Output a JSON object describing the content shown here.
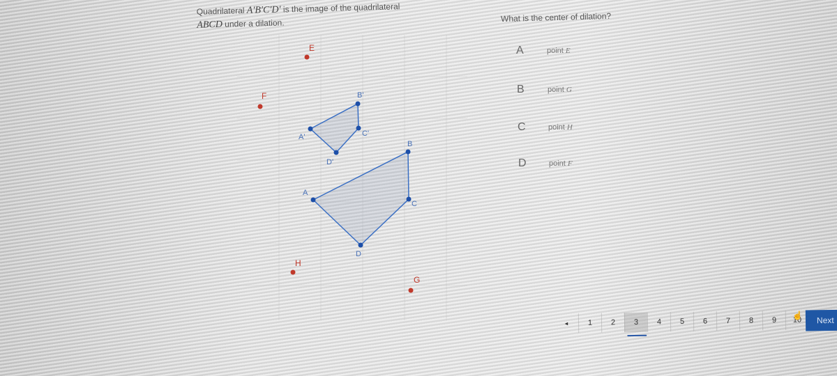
{
  "prompt": {
    "prefix": "Quadrilateral",
    "image_name": "A′B′C′D′",
    "middle": "is the image of the quadrilateral",
    "original_name": "ABCD",
    "suffix": "under a dilation."
  },
  "graph": {
    "points": {
      "E": {
        "label": "E",
        "color": "#c0392b"
      },
      "F": {
        "label": "F",
        "color": "#c0392b"
      },
      "G": {
        "label": "G",
        "color": "#c0392b"
      },
      "H": {
        "label": "H",
        "color": "#c0392b"
      }
    },
    "image_quad": {
      "labels": [
        "A'",
        "B'",
        "C'",
        "D'"
      ],
      "color": "#2f5fb3"
    },
    "original_quad": {
      "labels": [
        "A",
        "B",
        "C",
        "D"
      ],
      "color": "#2f5fb3"
    }
  },
  "question": {
    "text": "What is the center of dilation?",
    "choices": [
      {
        "letter": "A",
        "prefix": "point",
        "var": "E"
      },
      {
        "letter": "B",
        "prefix": "point",
        "var": "G"
      },
      {
        "letter": "C",
        "prefix": "point",
        "var": "H"
      },
      {
        "letter": "D",
        "prefix": "point",
        "var": "F"
      }
    ]
  },
  "pagination": {
    "prev_icon": "◂",
    "pages": [
      "1",
      "2",
      "3",
      "4",
      "5",
      "6",
      "7",
      "8",
      "9",
      "10"
    ],
    "current": "3",
    "next_label": "Next",
    "accent": "#1f57a5"
  }
}
